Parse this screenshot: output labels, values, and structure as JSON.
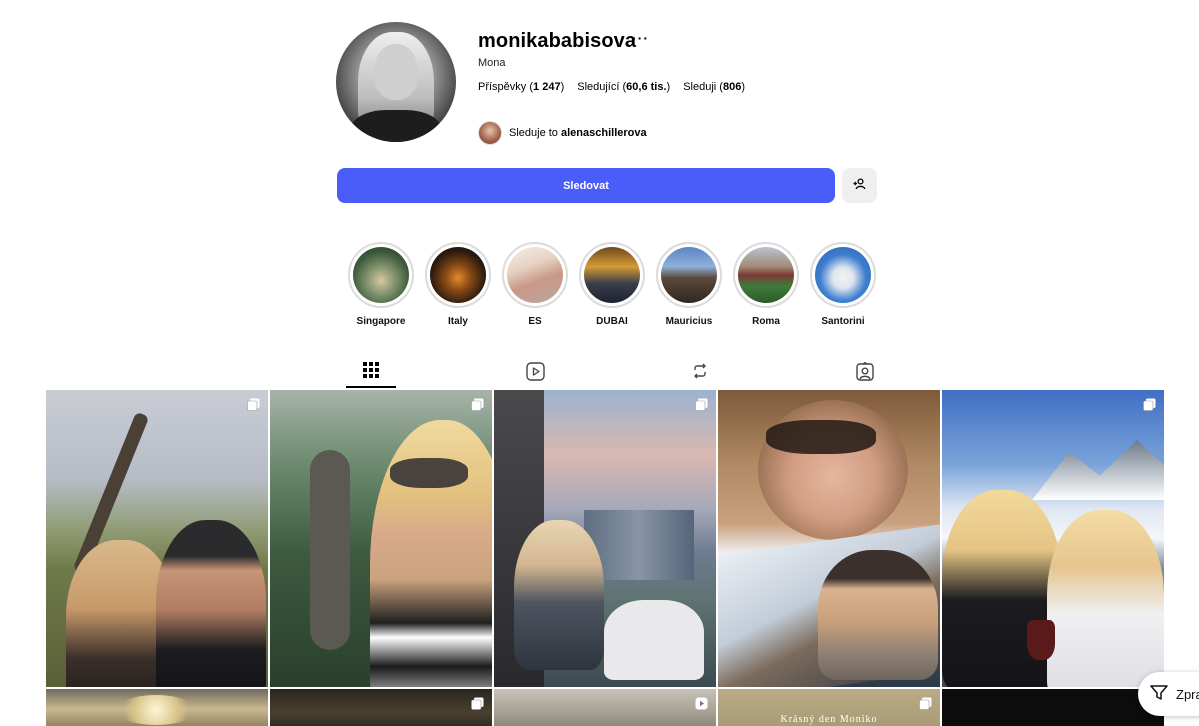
{
  "profile": {
    "username": "monikababisova",
    "more": "···",
    "full_name": "Mona",
    "stats": [
      {
        "label": "Příspěvky",
        "value": "1 247"
      },
      {
        "label": "Sledující",
        "value": "60,6 tis."
      },
      {
        "label": "Sleduji",
        "value": "806"
      }
    ],
    "followed_by_prefix": "Sleduje to",
    "followed_by_user": "alenaschillerova"
  },
  "actions": {
    "follow_label": "Sledovat",
    "suggest_icon": "person-add-icon"
  },
  "highlights": [
    {
      "label": "Singapore",
      "icon": "highlight-cover"
    },
    {
      "label": "Italy",
      "icon": "highlight-cover"
    },
    {
      "label": "ES",
      "icon": "highlight-cover"
    },
    {
      "label": "DUBAI",
      "icon": "highlight-cover"
    },
    {
      "label": "Mauricius",
      "icon": "highlight-cover"
    },
    {
      "label": "Roma",
      "icon": "highlight-cover"
    },
    {
      "label": "Santorini",
      "icon": "highlight-cover"
    }
  ],
  "tabs": [
    {
      "name": "posts",
      "icon": "grid-icon",
      "active": true
    },
    {
      "name": "reels",
      "icon": "reels-icon",
      "active": false
    },
    {
      "name": "reposts",
      "icon": "repost-icon",
      "active": false
    },
    {
      "name": "tagged",
      "icon": "tagged-icon",
      "active": false
    }
  ],
  "posts": [
    {
      "type": "carousel"
    },
    {
      "type": "carousel"
    },
    {
      "type": "carousel"
    },
    {
      "type": "photo"
    },
    {
      "type": "carousel"
    },
    {
      "type": "photo"
    },
    {
      "type": "carousel"
    },
    {
      "type": "video"
    },
    {
      "type": "carousel",
      "caption": "Krásný den Moniko"
    },
    {
      "type": "photo"
    }
  ],
  "floating": {
    "translate_label": "Zpra"
  },
  "colors": {
    "accent": "#4a5df9",
    "secondary_button": "#efefef",
    "ring": "#dbdbdb"
  }
}
